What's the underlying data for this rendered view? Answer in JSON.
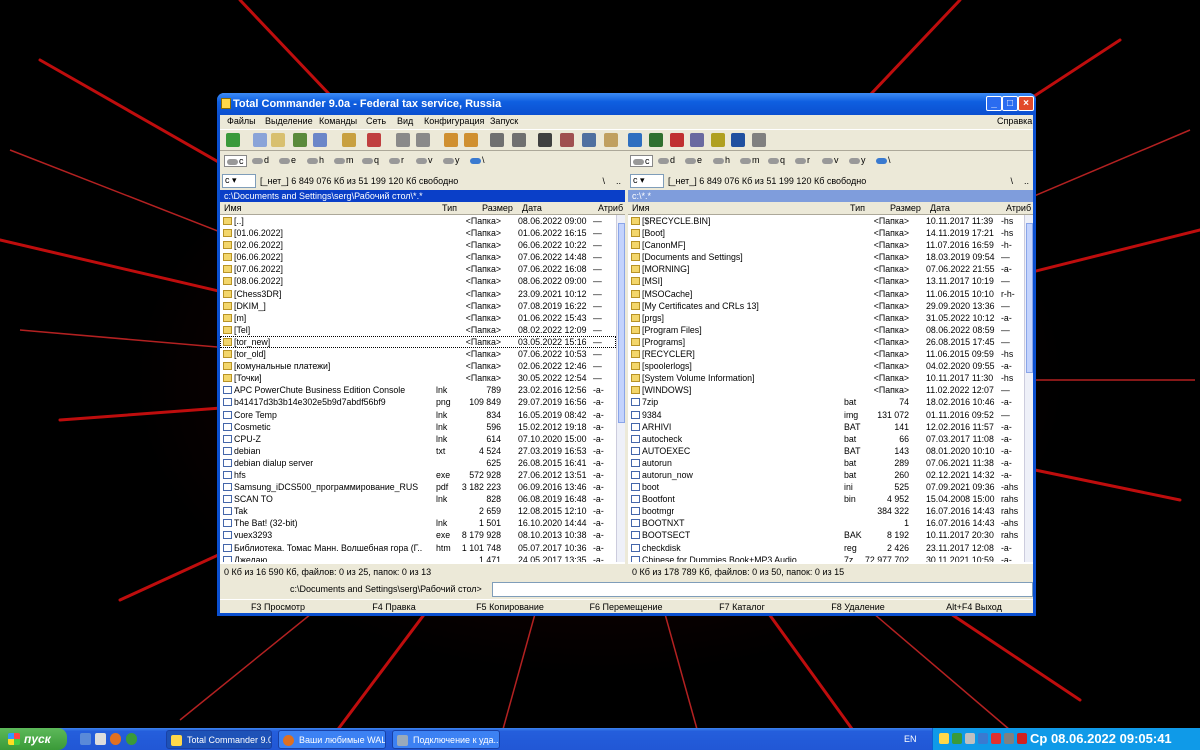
{
  "window": {
    "title": "Total Commander 9.0a - Federal tax service, Russia"
  },
  "menu": {
    "items": [
      "Файлы",
      "Выделение",
      "Команды",
      "Сеть",
      "Вид",
      "Конфигурация",
      "Запуск"
    ],
    "help": "Справка"
  },
  "drives": [
    "c",
    "d",
    "e",
    "h",
    "m",
    "q",
    "r",
    "v",
    "y",
    "\\"
  ],
  "left": {
    "drive": "c",
    "free": "[_нет_]  6 849 076 Кб из 51 199 120 Кб свободно",
    "path": "c:\\Documents and Settings\\serg\\Рабочий стол\\*.*",
    "headers": {
      "name": "Имя",
      "ext": "Тип",
      "size": "Размер",
      "date": "Дата",
      "attr": "Атриб"
    },
    "status": "0 Кб из 16 590 Кб, файлов: 0 из 25, папок: 0 из 13",
    "rows": [
      {
        "n": "[..]",
        "e": "",
        "s": "<Папка>",
        "d": "08.06.2022 09:00",
        "a": "—",
        "t": "fold"
      },
      {
        "n": "[01.06.2022]",
        "e": "",
        "s": "<Папка>",
        "d": "01.06.2022 16:15",
        "a": "—",
        "t": "fold"
      },
      {
        "n": "[02.06.2022]",
        "e": "",
        "s": "<Папка>",
        "d": "06.06.2022 10:22",
        "a": "—",
        "t": "fold"
      },
      {
        "n": "[06.06.2022]",
        "e": "",
        "s": "<Папка>",
        "d": "07.06.2022 14:48",
        "a": "—",
        "t": "fold"
      },
      {
        "n": "[07.06.2022]",
        "e": "",
        "s": "<Папка>",
        "d": "07.06.2022 16:08",
        "a": "—",
        "t": "fold"
      },
      {
        "n": "[08.06.2022]",
        "e": "",
        "s": "<Папка>",
        "d": "08.06.2022 09:00",
        "a": "—",
        "t": "fold"
      },
      {
        "n": "[Chess3DR]",
        "e": "",
        "s": "<Папка>",
        "d": "23.09.2021 10:12",
        "a": "—",
        "t": "fold"
      },
      {
        "n": "[DKIM_]",
        "e": "",
        "s": "<Папка>",
        "d": "07.08.2019 16:22",
        "a": "—",
        "t": "fold"
      },
      {
        "n": "[m]",
        "e": "",
        "s": "<Папка>",
        "d": "01.06.2022 15:43",
        "a": "—",
        "t": "fold"
      },
      {
        "n": "[Tel]",
        "e": "",
        "s": "<Папка>",
        "d": "08.02.2022 12:09",
        "a": "—",
        "t": "fold"
      },
      {
        "n": "[tor_new]",
        "e": "",
        "s": "<Папка>",
        "d": "03.05.2022 15:16",
        "a": "—",
        "t": "fold",
        "cur": true
      },
      {
        "n": "[tor_old]",
        "e": "",
        "s": "<Папка>",
        "d": "07.06.2022 10:53",
        "a": "—",
        "t": "fold"
      },
      {
        "n": "[комунальные платежи]",
        "e": "",
        "s": "<Папка>",
        "d": "02.06.2022 12:46",
        "a": "—",
        "t": "fold"
      },
      {
        "n": "[Точки]",
        "e": "",
        "s": "<Папка>",
        "d": "30.05.2022 12:54",
        "a": "—",
        "t": "fold"
      },
      {
        "n": "APC PowerChute Business Edition Console",
        "e": "lnk",
        "s": "789",
        "d": "23.02.2016 12:56",
        "a": "-a-",
        "t": "fil"
      },
      {
        "n": "b41417d3b3b14e302e5b9d7abdf56bf9",
        "e": "png",
        "s": "109 849",
        "d": "29.07.2019 16:56",
        "a": "-a-",
        "t": "fil"
      },
      {
        "n": "Core Temp",
        "e": "lnk",
        "s": "834",
        "d": "16.05.2019 08:42",
        "a": "-a-",
        "t": "fil"
      },
      {
        "n": "Cosmetic",
        "e": "lnk",
        "s": "596",
        "d": "15.02.2012 19:18",
        "a": "-a-",
        "t": "fil"
      },
      {
        "n": "CPU-Z",
        "e": "lnk",
        "s": "614",
        "d": "07.10.2020 15:00",
        "a": "-a-",
        "t": "fil"
      },
      {
        "n": "debian",
        "e": "txt",
        "s": "4 524",
        "d": "27.03.2019 16:53",
        "a": "-a-",
        "t": "fil"
      },
      {
        "n": "debian dialup server",
        "e": "",
        "s": "625",
        "d": "26.08.2015 16:41",
        "a": "-a-",
        "t": "fil"
      },
      {
        "n": "hfs",
        "e": "exe",
        "s": "572 928",
        "d": "27.06.2012 13:51",
        "a": "-a-",
        "t": "fil"
      },
      {
        "n": "Samsung_iDCS500_программирование_RUS",
        "e": "pdf",
        "s": "3 182 223",
        "d": "06.09.2016 13:46",
        "a": "-a-",
        "t": "fil"
      },
      {
        "n": "SCAN TO",
        "e": "lnk",
        "s": "828",
        "d": "06.08.2019 16:48",
        "a": "-a-",
        "t": "fil"
      },
      {
        "n": "Tak",
        "e": "",
        "s": "2 659",
        "d": "12.08.2015 12:10",
        "a": "-a-",
        "t": "fil"
      },
      {
        "n": "The Bat! (32-bit)",
        "e": "lnk",
        "s": "1 501",
        "d": "16.10.2020 14:44",
        "a": "-a-",
        "t": "fil"
      },
      {
        "n": "vuex3293",
        "e": "exe",
        "s": "8 179 928",
        "d": "08.10.2013 10:38",
        "a": "-a-",
        "t": "fil"
      },
      {
        "n": "Библиотека. Томас Манн. Волшебная гора (Г..",
        "e": "htm",
        "s": "1 101 748",
        "d": "05.07.2017 10:36",
        "a": "-a-",
        "t": "fil"
      },
      {
        "n": "Джедаю",
        "e": "",
        "s": "1 471",
        "d": "24.05.2017 13:35",
        "a": "-a-",
        "t": "fil"
      }
    ]
  },
  "right": {
    "drive": "c",
    "free": "[_нет_]  6 849 076 Кб из 51 199 120 Кб свободно",
    "path": "c:\\*.*",
    "headers": {
      "name": "Имя",
      "ext": "Тип",
      "size": "Размер",
      "date": "Дата",
      "attr": "Атриб"
    },
    "status": "0 Кб из 178 789 Кб, файлов: 0 из 50, папок: 0 из 15",
    "rows": [
      {
        "n": "[$RECYCLE.BIN]",
        "e": "",
        "s": "<Папка>",
        "d": "10.11.2017 11:39",
        "a": "-hs",
        "t": "fold"
      },
      {
        "n": "[Boot]",
        "e": "",
        "s": "<Папка>",
        "d": "14.11.2019 17:21",
        "a": "-hs",
        "t": "fold"
      },
      {
        "n": "[CanonMF]",
        "e": "",
        "s": "<Папка>",
        "d": "11.07.2016 16:59",
        "a": "-h-",
        "t": "fold"
      },
      {
        "n": "[Documents and Settings]",
        "e": "",
        "s": "<Папка>",
        "d": "18.03.2019 09:54",
        "a": "—",
        "t": "fold"
      },
      {
        "n": "[MORNING]",
        "e": "",
        "s": "<Папка>",
        "d": "07.06.2022 21:55",
        "a": "-a-",
        "t": "fold"
      },
      {
        "n": "[MSI]",
        "e": "",
        "s": "<Папка>",
        "d": "13.11.2017 10:19",
        "a": "—",
        "t": "fold"
      },
      {
        "n": "[MSOCache]",
        "e": "",
        "s": "<Папка>",
        "d": "11.06.2015 10:10",
        "a": "r-h-",
        "t": "fold"
      },
      {
        "n": "[My Certificates and CRLs 13]",
        "e": "",
        "s": "<Папка>",
        "d": "29.09.2020 13:36",
        "a": "—",
        "t": "fold"
      },
      {
        "n": "[prgs]",
        "e": "",
        "s": "<Папка>",
        "d": "31.05.2022 10:12",
        "a": "-a-",
        "t": "fold"
      },
      {
        "n": "[Program Files]",
        "e": "",
        "s": "<Папка>",
        "d": "08.06.2022 08:59",
        "a": "—",
        "t": "fold"
      },
      {
        "n": "[Programs]",
        "e": "",
        "s": "<Папка>",
        "d": "26.08.2015 17:45",
        "a": "—",
        "t": "fold"
      },
      {
        "n": "[RECYCLER]",
        "e": "",
        "s": "<Папка>",
        "d": "11.06.2015 09:59",
        "a": "-hs",
        "t": "fold"
      },
      {
        "n": "[spoolerlogs]",
        "e": "",
        "s": "<Папка>",
        "d": "04.02.2020 09:55",
        "a": "-a-",
        "t": "fold"
      },
      {
        "n": "[System Volume Information]",
        "e": "",
        "s": "<Папка>",
        "d": "10.11.2017 11:30",
        "a": "-hs",
        "t": "fold"
      },
      {
        "n": "[WINDOWS]",
        "e": "",
        "s": "<Папка>",
        "d": "11.02.2022 12:07",
        "a": "—",
        "t": "fold"
      },
      {
        "n": "7zip",
        "e": "bat",
        "s": "74",
        "d": "18.02.2016 10:46",
        "a": "-a-",
        "t": "fil"
      },
      {
        "n": "9384",
        "e": "img",
        "s": "131 072",
        "d": "01.11.2016 09:52",
        "a": "—",
        "t": "fil"
      },
      {
        "n": "ARHIVI",
        "e": "BAT",
        "s": "141",
        "d": "12.02.2016 11:57",
        "a": "-a-",
        "t": "fil"
      },
      {
        "n": "autocheck",
        "e": "bat",
        "s": "66",
        "d": "07.03.2017 11:08",
        "a": "-a-",
        "t": "fil"
      },
      {
        "n": "AUTOEXEC",
        "e": "BAT",
        "s": "143",
        "d": "08.01.2020 10:10",
        "a": "-a-",
        "t": "fil"
      },
      {
        "n": "autorun",
        "e": "bat",
        "s": "289",
        "d": "07.06.2021 11:38",
        "a": "-a-",
        "t": "fil"
      },
      {
        "n": "autorun_now",
        "e": "bat",
        "s": "260",
        "d": "02.12.2021 14:32",
        "a": "-a-",
        "t": "fil"
      },
      {
        "n": "boot",
        "e": "ini",
        "s": "525",
        "d": "07.09.2021 09:36",
        "a": "-ahs",
        "t": "fil"
      },
      {
        "n": "Bootfont",
        "e": "bin",
        "s": "4 952",
        "d": "15.04.2008 15:00",
        "a": "rahs",
        "t": "fil"
      },
      {
        "n": "bootmgr",
        "e": "",
        "s": "384 322",
        "d": "16.07.2016 14:43",
        "a": "rahs",
        "t": "fil"
      },
      {
        "n": "BOOTNXT",
        "e": "",
        "s": "1",
        "d": "16.07.2016 14:43",
        "a": "-ahs",
        "t": "fil"
      },
      {
        "n": "BOOTSECT",
        "e": "BAK",
        "s": "8 192",
        "d": "10.11.2017 20:30",
        "a": "rahs",
        "t": "fil"
      },
      {
        "n": "checkdisk",
        "e": "reg",
        "s": "2 426",
        "d": "23.11.2017 12:08",
        "a": "-a-",
        "t": "fil"
      },
      {
        "n": "Chinese for Dummies Book+MP3 Audio",
        "e": "7z",
        "s": "72 977 702",
        "d": "30.11.2021 10:59",
        "a": "-a-",
        "t": "fil"
      }
    ]
  },
  "cmdline": {
    "label": "c:\\Documents and Settings\\serg\\Рабочий стол>"
  },
  "fkeys": [
    "F3 Просмотр",
    "F4 Правка",
    "F5 Копирование",
    "F6 Перемещение",
    "F7 Каталог",
    "F8 Удаление",
    "Alt+F4 Выход"
  ],
  "taskbar": {
    "start": "пуск",
    "tasks": [
      "Total Commander 9.0...",
      "Ваши любимые WAL...",
      "Подключение к уда..."
    ],
    "lang": "EN",
    "clock": "Ср  08.06.2022    09:05:41"
  }
}
